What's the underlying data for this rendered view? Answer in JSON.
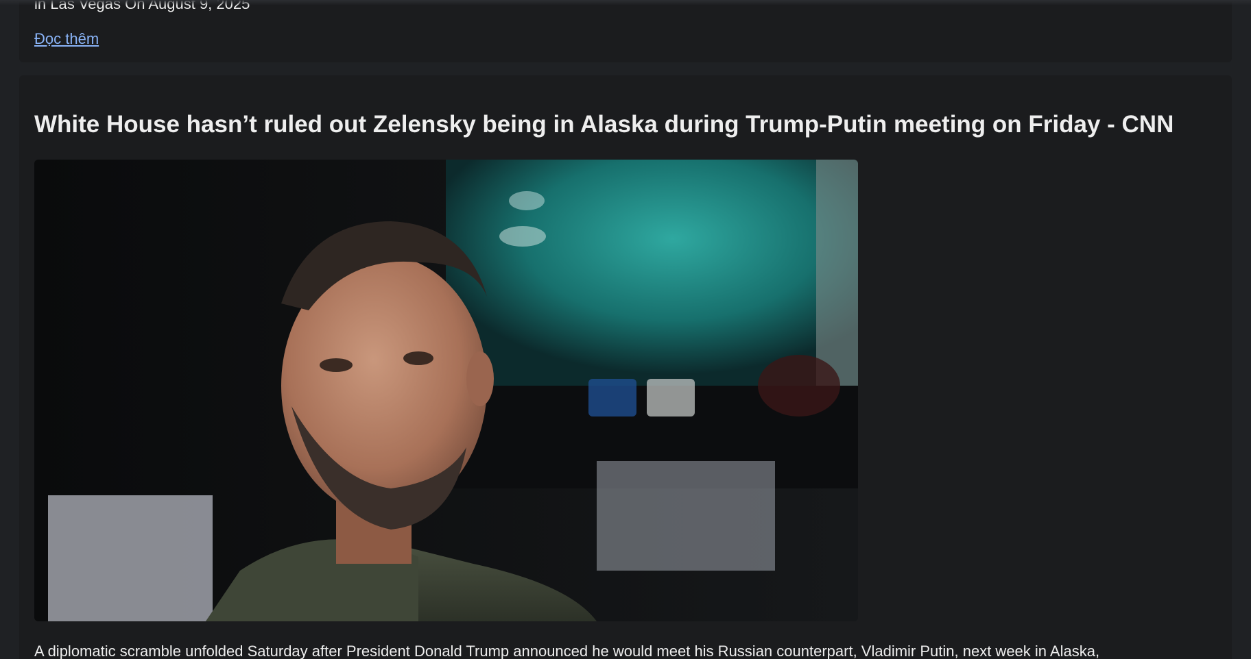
{
  "previous_article": {
    "caption_tail": "in Las Vegas On August 9, 2025",
    "read_more_label": "Đọc thêm"
  },
  "article": {
    "title": "White House hasn’t ruled out Zelensky being in Alaska during Trump-Putin meeting on Friday - CNN",
    "image_icon": "news-photo",
    "summary": "A diplomatic scramble unfolded Saturday after President Donald Trump announced he would meet his Russian counterpart, Vladimir Putin, next week in Alaska,"
  },
  "colors": {
    "page_background": "#1f2124",
    "card_background": "#1b1c1e",
    "link": "#8ab4f8",
    "text": "#eeeeee"
  }
}
